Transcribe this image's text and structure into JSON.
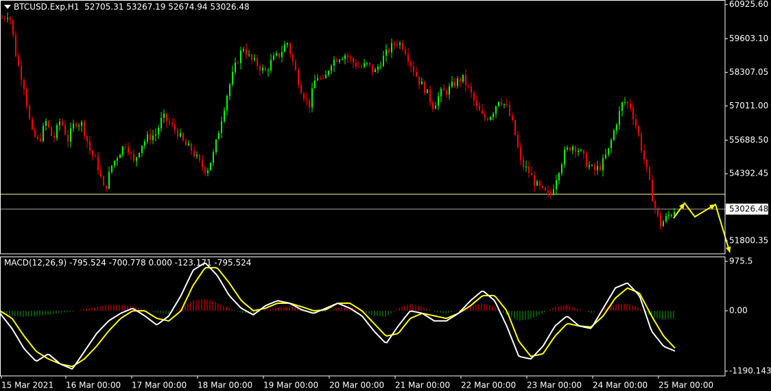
{
  "header": {
    "symbol": "BTCUSD.Exp,H1",
    "ohlc": "52705.31 53267.19 52674.94 53026.48"
  },
  "macd_header": {
    "label": "MACD(12,26,9) -795.524 -700.778 0.000 -123.171 -795.524"
  },
  "colors": {
    "background": "#000000",
    "bull": "#00ff00",
    "bear": "#ff0000",
    "macd_line": "#ffffff",
    "signal_line": "#ffff00",
    "hist_pos": "#ff0000",
    "hist_neg": "#00aa00",
    "level_line": "#ffff99",
    "arrows": "#ffff00",
    "axis": "#ffffff"
  },
  "chart_data": [
    {
      "type": "candlestick",
      "title": "BTCUSD.Exp,H1",
      "ylim": [
        51300,
        61100
      ],
      "y_ticks": [
        "60925.60",
        "59603.10",
        "58307.05",
        "57011.00",
        "55688.50",
        "54392.45",
        "51800.35"
      ],
      "current_price_label": "53026.48",
      "horizontal_levels": [
        53600,
        53026.48
      ],
      "x_labels": [
        "15 Mar 2021",
        "16 Mar 00:00",
        "17 Mar 00:00",
        "18 Mar 00:00",
        "19 Mar 00:00",
        "20 Mar 00:00",
        "21 Mar 00:00",
        "22 Mar 00:00",
        "23 Mar 00:00",
        "24 Mar 00:00",
        "25 Mar 00:00"
      ],
      "close_path": [
        60400,
        60600,
        58800,
        57800,
        56000,
        55600,
        56400,
        55700,
        56500,
        55700,
        56400,
        56300,
        55300,
        54800,
        53700,
        54700,
        55200,
        55600,
        54800,
        55500,
        55800,
        55900,
        56600,
        56300,
        56000,
        55500,
        55300,
        54800,
        54500,
        55200,
        56500,
        57700,
        58600,
        59300,
        58800,
        58600,
        58300,
        58800,
        59000,
        59500,
        58500,
        57600,
        57000,
        58200,
        57900,
        58700,
        58900,
        59000,
        58700,
        58500,
        58600,
        58300,
        58800,
        59200,
        59500,
        59300,
        58600,
        58000,
        57600,
        57000,
        57500,
        57600,
        57900,
        58100,
        57600,
        56900,
        56500,
        56700,
        57300,
        57000,
        56200,
        54800,
        54500,
        54000,
        53700,
        53500,
        54400,
        55200,
        55500,
        55300,
        54800,
        54500,
        54700,
        55300,
        56300,
        57200,
        57000,
        56000,
        54800,
        53500,
        52400,
        52700,
        53000
      ]
    },
    {
      "type": "line",
      "title": "MACD(12,26,9)",
      "ylim": [
        -1190.143,
        975.5
      ],
      "y_ticks": [
        "975.5",
        "0.00",
        "-1190.143"
      ],
      "series": [
        {
          "name": "MACD",
          "values": [
            -50,
            -350,
            -750,
            -1000,
            -850,
            -1050,
            -1150,
            -800,
            -450,
            -200,
            -50,
            50,
            -100,
            -280,
            -100,
            300,
            800,
            950,
            700,
            300,
            50,
            -80,
            100,
            200,
            150,
            20,
            -50,
            50,
            150,
            50,
            -100,
            -400,
            -650,
            -300,
            0,
            -50,
            -200,
            -200,
            -50,
            200,
            400,
            200,
            -300,
            -900,
            -950,
            -700,
            -300,
            -100,
            -300,
            -350,
            50,
            450,
            550,
            300,
            -400,
            -700,
            -800
          ]
        },
        {
          "name": "Signal",
          "values": [
            0,
            -150,
            -500,
            -800,
            -950,
            -1050,
            -1100,
            -950,
            -700,
            -400,
            -150,
            0,
            0,
            -150,
            -200,
            0,
            500,
            850,
            850,
            550,
            200,
            0,
            50,
            150,
            150,
            80,
            0,
            20,
            150,
            150,
            0,
            -250,
            -500,
            -450,
            -150,
            -50,
            -100,
            -150,
            -50,
            100,
            300,
            300,
            0,
            -600,
            -900,
            -850,
            -500,
            -250,
            -300,
            -320,
            -100,
            250,
            450,
            350,
            -100,
            -500,
            -750
          ]
        },
        {
          "name": "Histogram",
          "values": [
            -60,
            -100,
            -120,
            -100,
            -80,
            -40,
            -20,
            40,
            80,
            120,
            120,
            90,
            30,
            -40,
            -60,
            60,
            200,
            240,
            160,
            50,
            -40,
            -60,
            20,
            70,
            90,
            40,
            -30,
            -20,
            60,
            80,
            -20,
            -100,
            -120,
            50,
            140,
            80,
            -20,
            -60,
            20,
            100,
            150,
            80,
            -80,
            -200,
            -160,
            -50,
            80,
            120,
            30,
            -40,
            40,
            130,
            140,
            60,
            -120,
            -180,
            -150
          ]
        }
      ],
      "x_labels": [
        "15 Mar 2021",
        "16 Mar 00:00",
        "17 Mar 00:00",
        "18 Mar 00:00",
        "19 Mar 00:00",
        "20 Mar 00:00",
        "21 Mar 00:00",
        "22 Mar 00:00",
        "23 Mar 00:00",
        "24 Mar 00:00",
        "25 Mar 00:00"
      ]
    }
  ]
}
